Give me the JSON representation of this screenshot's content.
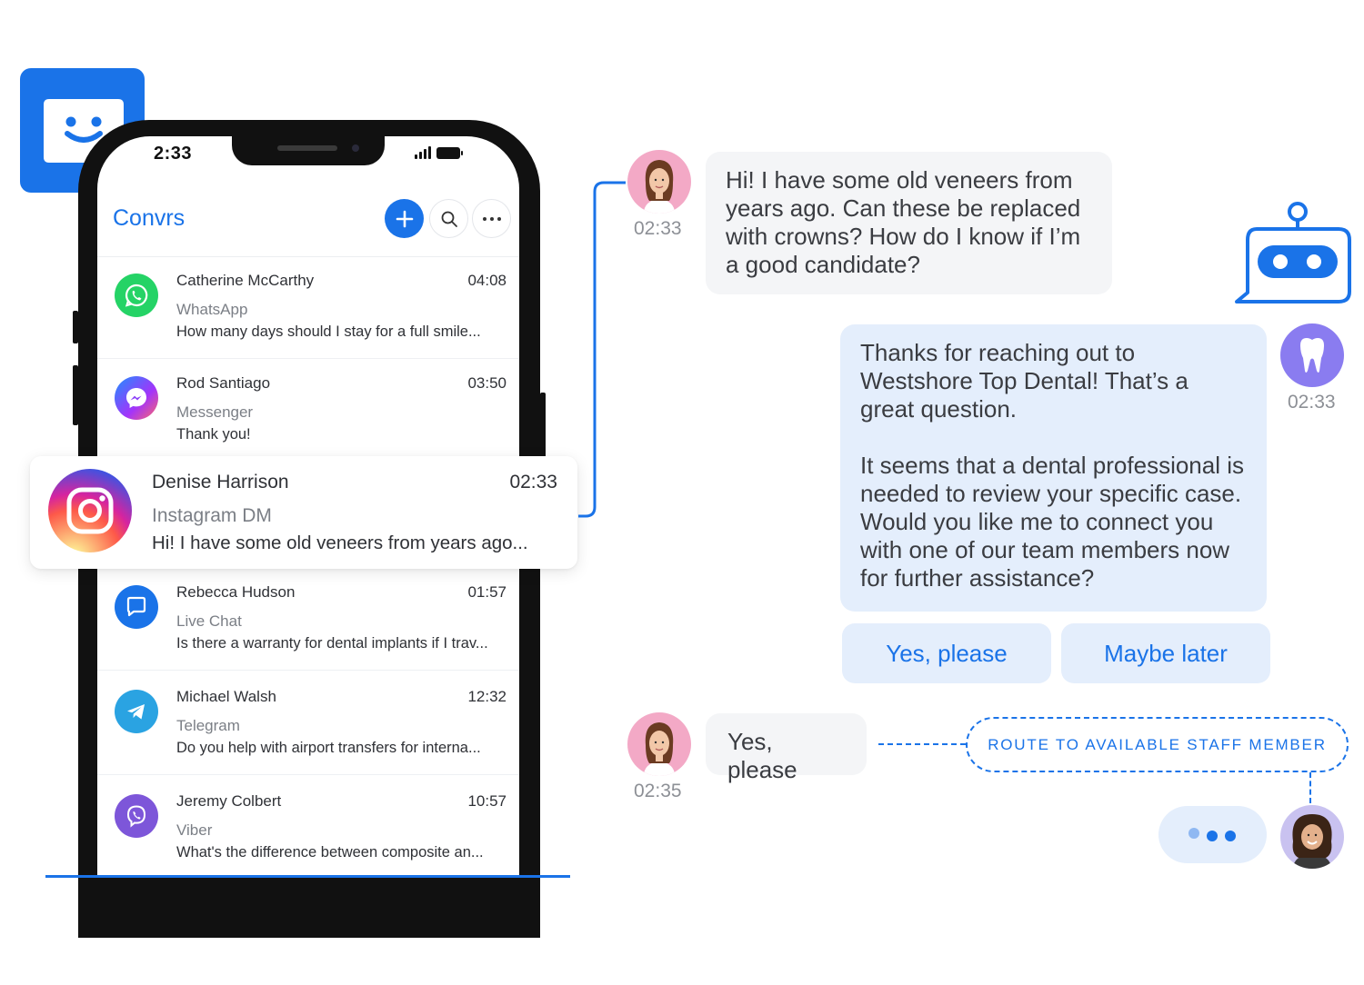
{
  "app": {
    "title": "Convrs",
    "status_time": "2:33",
    "accent": "#1a73e8"
  },
  "header": {
    "add_icon": "plus-icon",
    "search_icon": "search-icon",
    "more_icon": "more-icon"
  },
  "conversations": [
    {
      "name": "Catherine McCarthy",
      "time": "04:08",
      "channel": "WhatsApp",
      "preview": "How many days should I stay for a full smile...",
      "icon": "whatsapp-icon",
      "color": "#25d366"
    },
    {
      "name": "Rod Santiago",
      "time": "03:50",
      "channel": "Messenger",
      "preview": "Thank you!",
      "icon": "messenger-icon",
      "color": "#a334fa"
    },
    {
      "name": "Rebecca Hudson",
      "time": "01:57",
      "channel": "Live Chat",
      "preview": "Is there a warranty for dental implants if I trav...",
      "icon": "live-chat-icon",
      "color": "#1a73e8"
    },
    {
      "name": "Michael Walsh",
      "time": "12:32",
      "channel": "Telegram",
      "preview": "Do you help with airport transfers for interna...",
      "icon": "telegram-icon",
      "color": "#2aa3e2"
    },
    {
      "name": "Jeremy Colbert",
      "time": "10:57",
      "channel": "Viber",
      "preview": "What's the difference between composite an...",
      "icon": "viber-icon",
      "color": "#7d56d9"
    }
  ],
  "featured": {
    "name": "Denise Harrison",
    "time": "02:33",
    "channel": "Instagram DM",
    "preview": "Hi! I have some old veneers from years ago...",
    "icon": "instagram-icon"
  },
  "chat": {
    "customer_message": "Hi! I have some old veneers from years ago. Can these be replaced with crowns? How do I know if I’m a good  candidate?",
    "customer_time": "02:33",
    "bot_message_1": "Thanks for reaching out to Westshore Top Dental! That’s a great question.",
    "bot_message_2": "It seems that a dental professional is needed to review your specific case. Would you like me to connect you with one of our team members now for further assistance?",
    "bot_time": "02:33",
    "quick_replies": [
      "Yes, please",
      "Maybe later"
    ],
    "customer_reply": "Yes, please",
    "customer_reply_time": "02:35",
    "route_label": "ROUTE TO AVAILABLE STAFF MEMBER"
  }
}
